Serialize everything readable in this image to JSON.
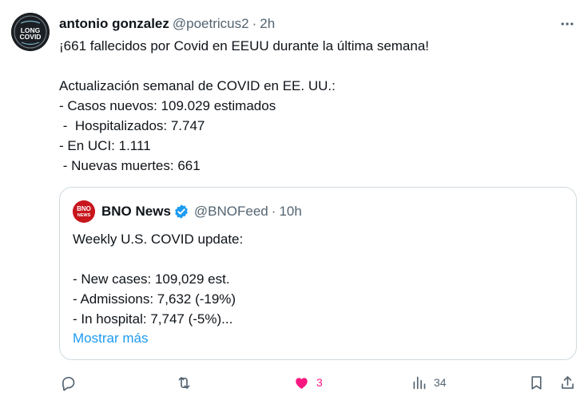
{
  "tweet": {
    "author_name": "antonio gonzalez",
    "author_handle": "@poetricus2",
    "separator": "·",
    "time": "2h",
    "avatar_text_top": "LONG",
    "avatar_text_bottom": "COVID",
    "text": "¡661 fallecidos por Covid en EEUU durante la última semana!\n\nActualización semanal de COVID en EE. UU.:\n- Casos nuevos: 109.029 estimados\n -  Hospitalizados: 7.747\n- En UCI: 1.111\n - Nuevas muertes: 661"
  },
  "quote": {
    "author_name": "BNO News",
    "author_handle": "@BNOFeed",
    "separator": "·",
    "time": "10h",
    "avatar_text_top": "BNO",
    "avatar_text_bottom": "NEWS",
    "text": "Weekly U.S. COVID update:\n\n- New cases: 109,029 est.\n- Admissions: 7,632 (-19%)\n- In hospital: 7,747 (-5%)...",
    "show_more": "Mostrar más"
  },
  "actions": {
    "likes": "3",
    "views": "34"
  },
  "colors": {
    "link": "#1d9bf0",
    "muted": "#536471",
    "like": "#f91880",
    "verified": "#1d9bf0",
    "bno_red": "#c8161d"
  },
  "icons": [
    "more-icon",
    "verified-icon",
    "reply-icon",
    "retweet-icon",
    "heart-icon",
    "views-icon",
    "bookmark-icon",
    "share-icon"
  ]
}
